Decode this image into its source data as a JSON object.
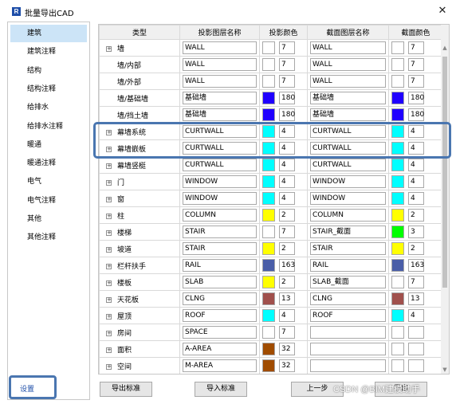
{
  "window": {
    "title": "批量导出CAD",
    "app_icon": "R"
  },
  "sidebar": {
    "items": [
      {
        "label": "建筑",
        "selected": true
      },
      {
        "label": "建筑注释"
      },
      {
        "label": "结构"
      },
      {
        "label": "结构注释"
      },
      {
        "label": "给排水"
      },
      {
        "label": "给排水注释"
      },
      {
        "label": "暖通"
      },
      {
        "label": "暖通注释"
      },
      {
        "label": "电气"
      },
      {
        "label": "电气注释"
      },
      {
        "label": "其他"
      },
      {
        "label": "其他注释"
      }
    ],
    "settings_label": "设置"
  },
  "table": {
    "columns": [
      "类型",
      "投影图层名称",
      "投影颜色",
      "截面图层名称",
      "截面颜色"
    ],
    "rows": [
      {
        "type": "墙",
        "expander": true,
        "indent": false,
        "proj_layer": "WALL",
        "proj_color": "#ffffff",
        "proj_num": "7",
        "cut_layer": "WALL",
        "cut_color": "#ffffff",
        "cut_num": "7"
      },
      {
        "type": "墙/内部",
        "expander": false,
        "indent": true,
        "proj_layer": "WALL",
        "proj_color": "#ffffff",
        "proj_num": "7",
        "cut_layer": "WALL",
        "cut_color": "#ffffff",
        "cut_num": "7"
      },
      {
        "type": "墙/外部",
        "expander": false,
        "indent": true,
        "proj_layer": "WALL",
        "proj_color": "#ffffff",
        "proj_num": "7",
        "cut_layer": "WALL",
        "cut_color": "#ffffff",
        "cut_num": "7"
      },
      {
        "type": "墙/基础墙",
        "expander": false,
        "indent": true,
        "proj_layer": "基础墙",
        "proj_color": "#2000ff",
        "proj_num": "180",
        "cut_layer": "基础墙",
        "cut_color": "#2000ff",
        "cut_num": "180"
      },
      {
        "type": "墙/挡土墙",
        "expander": false,
        "indent": true,
        "proj_layer": "基础墙",
        "proj_color": "#2000ff",
        "proj_num": "180",
        "cut_layer": "基础墙",
        "cut_color": "#2000ff",
        "cut_num": "180"
      },
      {
        "type": "幕墙系统",
        "expander": true,
        "indent": false,
        "proj_layer": "CURTWALL",
        "proj_color": "#00ffff",
        "proj_num": "4",
        "cut_layer": "CURTWALL",
        "cut_color": "#00ffff",
        "cut_num": "4"
      },
      {
        "type": "幕墙嵌板",
        "expander": true,
        "indent": false,
        "proj_layer": "CURTWALL",
        "proj_color": "#00ffff",
        "proj_num": "4",
        "cut_layer": "CURTWALL",
        "cut_color": "#00ffff",
        "cut_num": "4"
      },
      {
        "type": "幕墙竖梃",
        "expander": true,
        "indent": false,
        "proj_layer": "CURTWALL",
        "proj_color": "#00ffff",
        "proj_num": "4",
        "cut_layer": "CURTWALL",
        "cut_color": "#00ffff",
        "cut_num": "4"
      },
      {
        "type": "门",
        "expander": true,
        "indent": false,
        "proj_layer": "WINDOW",
        "proj_color": "#00ffff",
        "proj_num": "4",
        "cut_layer": "WINDOW",
        "cut_color": "#00ffff",
        "cut_num": "4"
      },
      {
        "type": "窗",
        "expander": true,
        "indent": false,
        "proj_layer": "WINDOW",
        "proj_color": "#00ffff",
        "proj_num": "4",
        "cut_layer": "WINDOW",
        "cut_color": "#00ffff",
        "cut_num": "4"
      },
      {
        "type": "柱",
        "expander": true,
        "indent": false,
        "proj_layer": "COLUMN",
        "proj_color": "#ffff00",
        "proj_num": "2",
        "cut_layer": "COLUMN",
        "cut_color": "#ffff00",
        "cut_num": "2"
      },
      {
        "type": "楼梯",
        "expander": true,
        "indent": false,
        "proj_layer": "STAIR",
        "proj_color": "#ffffff",
        "proj_num": "7",
        "cut_layer": "STAIR_截面",
        "cut_color": "#00ff00",
        "cut_num": "3"
      },
      {
        "type": "坡道",
        "expander": true,
        "indent": false,
        "proj_layer": "STAIR",
        "proj_color": "#ffff00",
        "proj_num": "2",
        "cut_layer": "STAIR",
        "cut_color": "#ffff00",
        "cut_num": "2"
      },
      {
        "type": "栏杆扶手",
        "expander": true,
        "indent": false,
        "proj_layer": "RAIL",
        "proj_color": "#4a5ea8",
        "proj_num": "163",
        "cut_layer": "RAIL",
        "cut_color": "#4a5ea8",
        "cut_num": "163"
      },
      {
        "type": "楼板",
        "expander": true,
        "indent": false,
        "proj_layer": "SLAB",
        "proj_color": "#ffff00",
        "proj_num": "2",
        "cut_layer": "SLAB_截面",
        "cut_color": "#ffffff",
        "cut_num": "7"
      },
      {
        "type": "天花板",
        "expander": true,
        "indent": false,
        "proj_layer": "CLNG",
        "proj_color": "#a0504c",
        "proj_num": "13",
        "cut_layer": "CLNG",
        "cut_color": "#a0504c",
        "cut_num": "13"
      },
      {
        "type": "屋顶",
        "expander": true,
        "indent": false,
        "proj_layer": "ROOF",
        "proj_color": "#00ffff",
        "proj_num": "4",
        "cut_layer": "ROOF",
        "cut_color": "#00ffff",
        "cut_num": "4"
      },
      {
        "type": "房间",
        "expander": true,
        "indent": false,
        "proj_layer": "SPACE",
        "proj_color": "#ffffff",
        "proj_num": "7",
        "cut_layer": "",
        "cut_color": "#ffffff",
        "cut_num": ""
      },
      {
        "type": "面积",
        "expander": true,
        "indent": false,
        "proj_layer": "A-AREA",
        "proj_color": "#a04c00",
        "proj_num": "32",
        "cut_layer": "",
        "cut_color": "#ffffff",
        "cut_num": ""
      },
      {
        "type": "空间",
        "expander": true,
        "indent": false,
        "proj_layer": "M-AREA",
        "proj_color": "#a04c00",
        "proj_num": "32",
        "cut_layer": "",
        "cut_color": "#ffffff",
        "cut_num": ""
      }
    ]
  },
  "buttons": {
    "export_standard": "导出标准",
    "import_standard": "导入标准",
    "prev_step": "上一步",
    "export": "导出"
  },
  "watermark": "CSDN @BIM建模助手"
}
